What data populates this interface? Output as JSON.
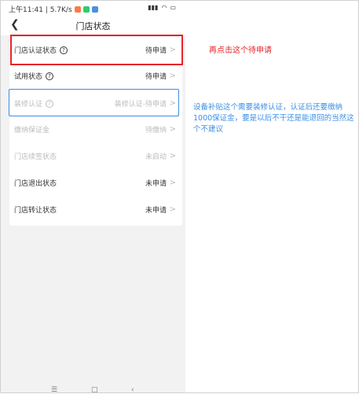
{
  "status_bar": {
    "left_text": "上午11:41 | 5.7K/s",
    "right_text": "4G 🔋",
    "icon_colors": [
      "#ff7a45",
      "#2ecc71",
      "#4a90e2"
    ]
  },
  "nav": {
    "back_icon": "chevron-left-icon",
    "title": "门店状态"
  },
  "rows": [
    {
      "label": "门店认证状态",
      "has_help": true,
      "value": "待申请",
      "dim": false
    },
    {
      "label": "试用状态",
      "has_help": true,
      "value": "待申请",
      "dim": false
    },
    {
      "label": "装修认证",
      "has_help": true,
      "value": "装修认证-待申请",
      "dim": true
    },
    {
      "label": "缴纳保证金",
      "has_help": false,
      "value": "待缴纳",
      "dim": true
    },
    {
      "label": "门店续签状态",
      "has_help": false,
      "value": "未启动",
      "dim": true
    },
    {
      "label": "门店退出状态",
      "has_help": false,
      "value": "未申请",
      "dim": false
    },
    {
      "label": "门店转让状态",
      "has_help": false,
      "value": "未申请",
      "dim": false
    }
  ],
  "annotations": {
    "red_note": "再点击这个待申请",
    "blue_note": "设备补贴这个需要装修认证，认证后还要缴纳1000保证金，要是以后不干还是能退回的当然这个不建议",
    "red_color": "#e5252a",
    "blue_color": "#3a8ee6"
  },
  "bottom_nav": {
    "icons": [
      "menu-icon",
      "home-icon",
      "back-icon"
    ]
  }
}
